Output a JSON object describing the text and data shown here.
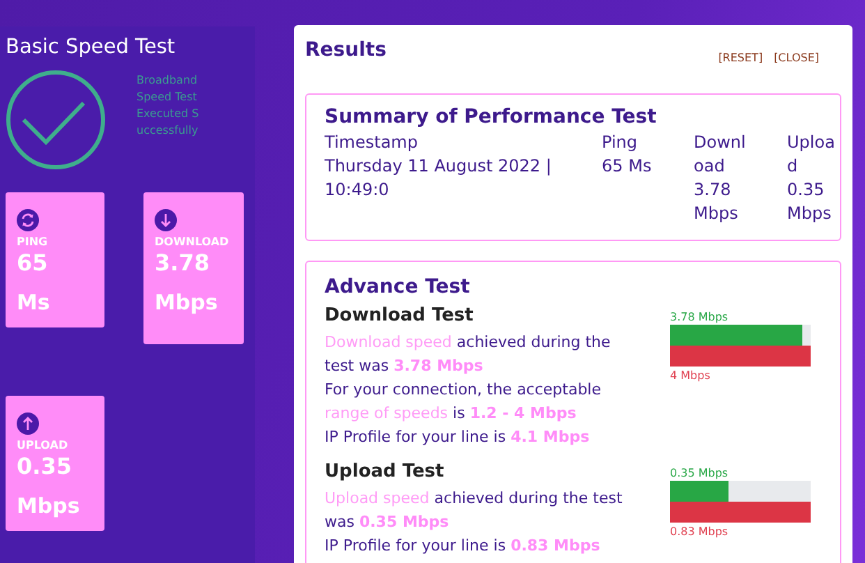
{
  "sidebar": {
    "title": "Basic Speed Test",
    "status_message": "Broadband Speed Test Executed Successfully",
    "tiles": [
      {
        "kind": "ping",
        "label": "PING",
        "value": "65",
        "unit": "Ms"
      },
      {
        "kind": "download",
        "label": "DOWNLOAD",
        "value": "3.78",
        "unit": "Mbps"
      },
      {
        "kind": "upload",
        "label": "UPLOAD",
        "value": "0.35",
        "unit": "Mbps"
      }
    ]
  },
  "results": {
    "title": "Results",
    "actions": [
      "[RESET]",
      "[CLOSE]"
    ],
    "summary": {
      "title": "Summary of Performance Test",
      "columns": [
        {
          "header": "Timestamp",
          "value": "Thursday 11 August 2022 | 10:49:0"
        },
        {
          "header": "Ping",
          "value": "65 Ms"
        },
        {
          "header": "Download",
          "value": "3.78 Mbps"
        },
        {
          "header": "Upload",
          "value": "0.35 Mbps"
        }
      ]
    },
    "advance": {
      "title": "Advance Test",
      "sections": [
        {
          "title": "Download Test",
          "paragraphs": [
            [
              {
                "kind": "highlight",
                "text": "Download speed"
              },
              {
                "kind": "plain",
                "text": " achieved during the test was "
              },
              {
                "kind": "value",
                "text": "3.78 Mbps"
              }
            ],
            [
              {
                "kind": "plain",
                "text": "For your connection, the acceptable "
              },
              {
                "kind": "highlight",
                "text": "range of speeds"
              },
              {
                "kind": "plain",
                "text": " is "
              },
              {
                "kind": "value",
                "text": "1.2 - 4 Mbps"
              }
            ],
            [
              {
                "kind": "plain",
                "text": "IP Profile for your line is "
              },
              {
                "kind": "value",
                "text": "4.1 Mbps"
              }
            ]
          ],
          "bars": [
            {
              "kind": "achieved",
              "label": "3.78 Mbps",
              "level": 0.945
            },
            {
              "kind": "profile",
              "label": "4 Mbps",
              "level": 1
            }
          ]
        },
        {
          "title": "Upload Test",
          "paragraphs": [
            [
              {
                "kind": "highlight",
                "text": "Upload speed"
              },
              {
                "kind": "plain",
                "text": " achieved during the test was "
              },
              {
                "kind": "value",
                "text": "0.35 Mbps"
              }
            ],
            [
              {
                "kind": "plain",
                "text": "IP Profile for your line is "
              },
              {
                "kind": "value",
                "text": "0.83 Mbps"
              }
            ]
          ],
          "bars": [
            {
              "kind": "achieved",
              "label": "0.35 Mbps",
              "level": 0.42
            },
            {
              "kind": "profile",
              "label": "0.83 Mbps",
              "level": 1
            }
          ]
        }
      ]
    }
  }
}
